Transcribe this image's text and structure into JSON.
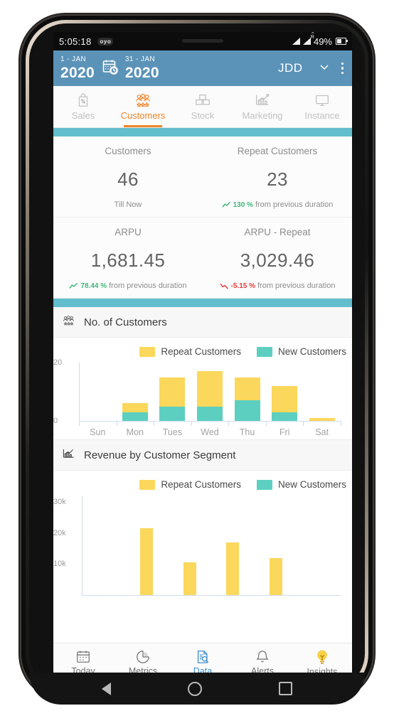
{
  "status_bar": {
    "time": "5:05:18",
    "carrier_badge": "oyo",
    "signal_1": "signal-icon",
    "signal_2": "signal-roaming-icon",
    "battery_text": "49%",
    "battery_icon": "battery-icon"
  },
  "app_bar": {
    "start_date_label": "1 - JAN",
    "start_date_year": "2020",
    "calendar_icon": "calendar-clock-icon",
    "end_date_label": "31 - JAN",
    "end_date_year": "2020",
    "user": "JDD",
    "chevron_icon": "chevron-down-icon",
    "overflow_icon": "kebab-menu-icon",
    "bg_color": "#5b93b8"
  },
  "tabs": {
    "active_color": "#f0862a",
    "items": [
      {
        "label": "Sales",
        "icon": "sales-tag-icon",
        "active": false
      },
      {
        "label": "Customers",
        "icon": "customers-group-icon",
        "active": true
      },
      {
        "label": "Stock",
        "icon": "stock-boxes-icon",
        "active": false
      },
      {
        "label": "Marketing",
        "icon": "marketing-chart-icon",
        "active": false
      },
      {
        "label": "Instance",
        "icon": "monitor-icon",
        "active": false
      }
    ]
  },
  "kpis": [
    {
      "title": "Customers",
      "value": "46",
      "sub_text": "Till Now",
      "trend": "none",
      "pct": ""
    },
    {
      "title": "Repeat Customers",
      "value": "23",
      "sub_text": "from previous duration",
      "trend": "up",
      "pct": "130 %"
    },
    {
      "title": "ARPU",
      "value": "1,681.45",
      "sub_text": "from previous duration",
      "trend": "up",
      "pct": "78.44 %"
    },
    {
      "title": "ARPU - Repeat",
      "value": "3,029.46",
      "sub_text": "from previous duration",
      "trend": "down",
      "pct": "-5.15 %"
    }
  ],
  "colors": {
    "repeat_customers": "#fbd75b",
    "new_customers": "#5ccfc0",
    "teal_band": "#62bdcc",
    "up": "#3cb878",
    "down": "#e23b3b",
    "nav_active": "#3f8fd0"
  },
  "chart_data": [
    {
      "type": "bar",
      "title": "No. of Customers",
      "icon": "customers-group-icon",
      "stacked": true,
      "categories": [
        "Sun",
        "Mon",
        "Tues",
        "Wed",
        "Thu",
        "Fri",
        "Sat"
      ],
      "series": [
        {
          "name": "New Customers",
          "color": "#5ccfc0",
          "values": [
            0,
            3,
            5,
            5,
            7,
            3,
            0
          ]
        },
        {
          "name": "Repeat Customers",
          "color": "#fbd75b",
          "values": [
            0,
            3,
            10,
            12,
            8,
            9,
            1
          ]
        }
      ],
      "legend": [
        "Repeat Customers",
        "New Customers"
      ],
      "legend_position": "top-right",
      "ylabel": "",
      "xlabel": "",
      "ylim": [
        0,
        20
      ],
      "yticks": [
        "0",
        "20"
      ],
      "grid": false
    },
    {
      "type": "bar",
      "title": "Revenue by Customer Segment",
      "icon": "bar-chart-icon",
      "stacked": false,
      "categories": [
        "",
        "",
        "",
        "",
        "",
        ""
      ],
      "series": [
        {
          "name": "Repeat Customers",
          "color": "#fbd75b",
          "values": [
            0,
            21500,
            10500,
            17000,
            12000,
            0
          ]
        }
      ],
      "legend": [
        "Repeat Customers",
        "New Customers"
      ],
      "legend_position": "top-right",
      "ylabel": "",
      "xlabel": "",
      "ylim": [
        0,
        32000
      ],
      "yticks": [
        "10k",
        "20k",
        "30k"
      ],
      "grid": false
    }
  ],
  "bottom_nav": {
    "items": [
      {
        "label": "Today",
        "icon": "calendar-icon",
        "active": false
      },
      {
        "label": "Metrics",
        "icon": "pie-chart-icon",
        "active": false
      },
      {
        "label": "Data",
        "icon": "data-document-search-icon",
        "active": true
      },
      {
        "label": "Alerts",
        "icon": "bell-icon",
        "active": false
      },
      {
        "label": "Insights",
        "icon": "lightbulb-icon",
        "active": false
      }
    ]
  },
  "android_nav": {
    "back": "back-triangle-icon",
    "home": "home-circle-icon",
    "recents": "recents-square-icon"
  }
}
